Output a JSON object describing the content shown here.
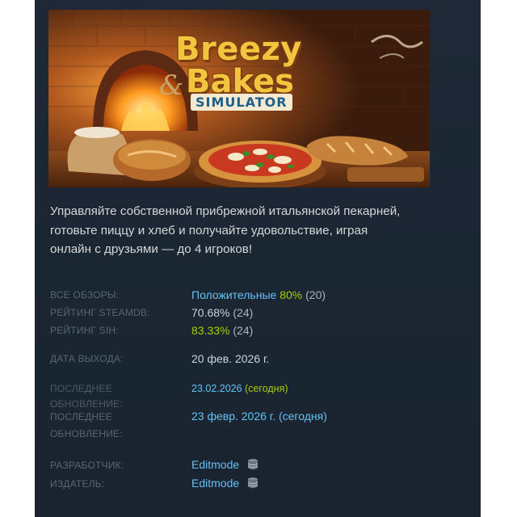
{
  "game": {
    "logo": {
      "line1": "Breezy",
      "ampersand": "&",
      "line2": "Bakes",
      "sub": "SIMULATOR"
    },
    "description": "Управляйте собственной прибрежной итальянской пекарней, готовьте пиццу и хлеб и получайте удовольствие, играя онлайн с друзьями — до 4 игроков!"
  },
  "details": {
    "reviews": {
      "label": "ВСЕ ОБЗОРЫ:",
      "summary": "Положительные",
      "percent": "80%",
      "count": "(20)"
    },
    "steamdb": {
      "label": "РЕЙТИНГ STEAMDB:",
      "percent": "70.68%",
      "count": "(24)"
    },
    "sih": {
      "label": "РЕЙТИНГ SIH:",
      "percent": "83.33%",
      "count": "(24)"
    },
    "release": {
      "label": "ДАТА ВЫХОДА:",
      "value": "20 фев. 2026 г."
    },
    "last_update_1": {
      "label": "ПОСЛЕДНЕЕ ОБНОВЛЕНИЕ:",
      "date": "23.02.2026",
      "note": "(сегодня)"
    },
    "last_update_2": {
      "label": "ПОСЛЕДНЕЕ ОБНОВЛЕНИЕ:",
      "value": "23 февр. 2026 г. (сегодня)"
    },
    "developer": {
      "label": "РАЗРАБОТЧИК:",
      "value": "Editmode",
      "icon": "database-stack-icon"
    },
    "publisher": {
      "label": "ИЗДАТЕЛЬ:",
      "value": "Editmode",
      "icon": "database-stack-icon"
    }
  },
  "colors": {
    "panel_bg": "#1b2633",
    "link_blue": "#66c0f4",
    "positive_green": "#a4d007",
    "label_gray": "#556772"
  }
}
